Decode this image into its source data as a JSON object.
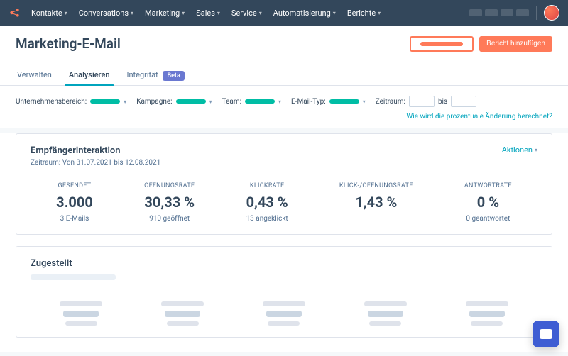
{
  "nav": {
    "items": [
      "Kontakte",
      "Conversations",
      "Marketing",
      "Sales",
      "Service",
      "Automatisierung",
      "Berichte"
    ]
  },
  "header": {
    "title": "Marketing-E-Mail",
    "add_report": "Bericht hinzufügen"
  },
  "tabs": {
    "manage": "Verwalten",
    "analyze": "Analysieren",
    "integrity": "Integrität",
    "beta": "Beta"
  },
  "filters": {
    "business_unit": "Unternehmensbereich:",
    "campaign": "Kampagne:",
    "team": "Team:",
    "email_type": "E-Mail-Typ:",
    "period": "Zeitraum:",
    "to": "bis"
  },
  "help_link": "Wie wird die prozentuale Änderung berechnet?",
  "card1": {
    "title": "Empfängerinteraktion",
    "subtitle": "Zeitraum: Von 31.07.2021 bis 12.08.2021",
    "actions": "Aktionen",
    "stats": [
      {
        "label": "GESENDET",
        "value": "3.000",
        "sub": "3 E-Mails"
      },
      {
        "label": "ÖFFNUNGSRATE",
        "value": "30,33 %",
        "sub": "910 geöffnet"
      },
      {
        "label": "KLICKRATE",
        "value": "0,43 %",
        "sub": "13 angeklickt"
      },
      {
        "label": "KLICK-/ÖFFNUNGSRATE",
        "value": "1,43 %",
        "sub": ""
      },
      {
        "label": "ANTWORTRATE",
        "value": "0 %",
        "sub": "0 geantwortet"
      }
    ]
  },
  "card2": {
    "title": "Zugestellt"
  }
}
